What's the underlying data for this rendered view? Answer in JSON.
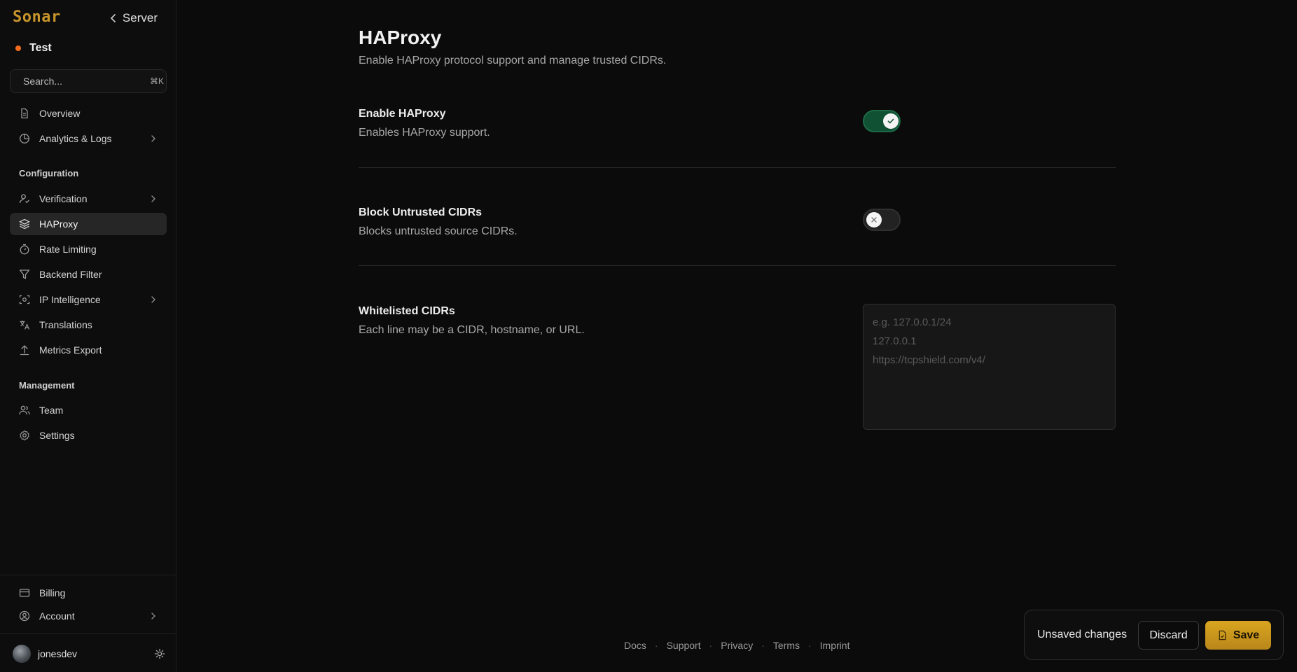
{
  "sidebar": {
    "logo": "Sonar",
    "back_label": "Server",
    "server_name": "Test",
    "search": {
      "placeholder": "Search...",
      "shortcut": "⌘K"
    },
    "items_top": [
      {
        "label": "Overview",
        "icon": "document-icon"
      },
      {
        "label": "Analytics & Logs",
        "icon": "chart-pie-icon",
        "has_submenu": true
      }
    ],
    "configuration_label": "Configuration",
    "configuration_items": [
      {
        "label": "Verification",
        "icon": "user-check-icon",
        "has_submenu": true
      },
      {
        "label": "HAProxy",
        "icon": "layers-icon",
        "active": true
      },
      {
        "label": "Rate Limiting",
        "icon": "timer-icon"
      },
      {
        "label": "Backend Filter",
        "icon": "filter-icon"
      },
      {
        "label": "IP Intelligence",
        "icon": "eye-scan-icon",
        "has_submenu": true
      },
      {
        "label": "Translations",
        "icon": "translate-icon"
      },
      {
        "label": "Metrics Export",
        "icon": "upload-icon"
      }
    ],
    "management_label": "Management",
    "management_items": [
      {
        "label": "Team",
        "icon": "users-icon"
      },
      {
        "label": "Settings",
        "icon": "gear-icon"
      }
    ],
    "bottom_items": [
      {
        "label": "Billing",
        "icon": "credit-card-icon"
      },
      {
        "label": "Account",
        "icon": "user-circle-icon",
        "has_submenu": true
      }
    ],
    "user": {
      "name": "jonesdev"
    }
  },
  "page": {
    "title": "HAProxy",
    "subtitle": "Enable HAProxy protocol support and manage trusted CIDRs."
  },
  "settings": {
    "enable_haproxy": {
      "title": "Enable HAProxy",
      "description": "Enables HAProxy support.",
      "enabled": true
    },
    "block_untrusted": {
      "title": "Block Untrusted CIDRs",
      "description": "Blocks untrusted source CIDRs.",
      "enabled": false
    },
    "whitelisted": {
      "title": "Whitelisted CIDRs",
      "description": "Each line may be a CIDR, hostname, or URL.",
      "value": "",
      "placeholder": "e.g. 127.0.0.1/24\n127.0.0.1\nhttps://tcpshield.com/v4/"
    }
  },
  "footer": {
    "links": [
      "Docs",
      "Support",
      "Privacy",
      "Terms",
      "Imprint"
    ],
    "separator": "·"
  },
  "unsaved_bar": {
    "message": "Unsaved changes",
    "discard_label": "Discard",
    "save_label": "Save"
  },
  "colors": {
    "brand": "#c7952b",
    "status_dot": "#f26b1d",
    "toggle_on": "#0f5132",
    "save_button": "#d9a520"
  }
}
